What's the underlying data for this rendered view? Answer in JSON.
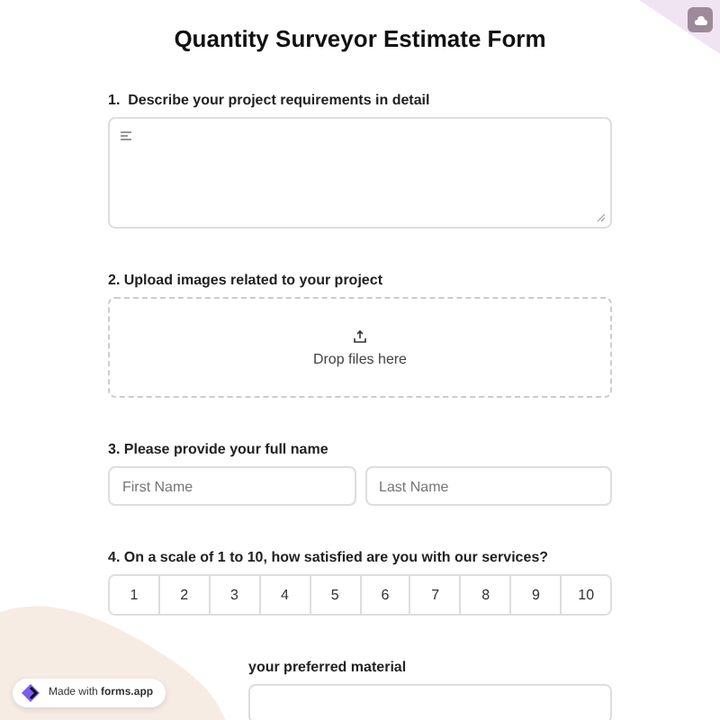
{
  "title": "Quantity Surveyor Estimate Form",
  "questions": [
    {
      "kind": "textarea",
      "label": "1.  Describe your project requirements in detail"
    },
    {
      "kind": "upload",
      "label": "2. Upload images related to your project",
      "hint": "Drop files here"
    },
    {
      "kind": "name",
      "label": "3. Please provide your full name",
      "fields": [
        {
          "placeholder": "First Name"
        },
        {
          "placeholder": "Last Name"
        }
      ]
    },
    {
      "kind": "scale",
      "label": "4. On a scale of 1 to 10, how satisfied are you with our services?",
      "options": [
        {
          "label": "1",
          "selected": false
        },
        {
          "label": "2",
          "selected": false
        },
        {
          "label": "3",
          "selected": false
        },
        {
          "label": "4",
          "selected": false
        },
        {
          "label": "5",
          "selected": false
        },
        {
          "label": "6",
          "selected": false
        },
        {
          "label": "7",
          "selected": false
        },
        {
          "label": "8",
          "selected": false
        },
        {
          "label": "9",
          "selected": false
        },
        {
          "label": "10",
          "selected": false
        }
      ]
    },
    {
      "kind": "select",
      "label": "your preferred material"
    }
  ],
  "badge": "Made with **forms.app**"
}
